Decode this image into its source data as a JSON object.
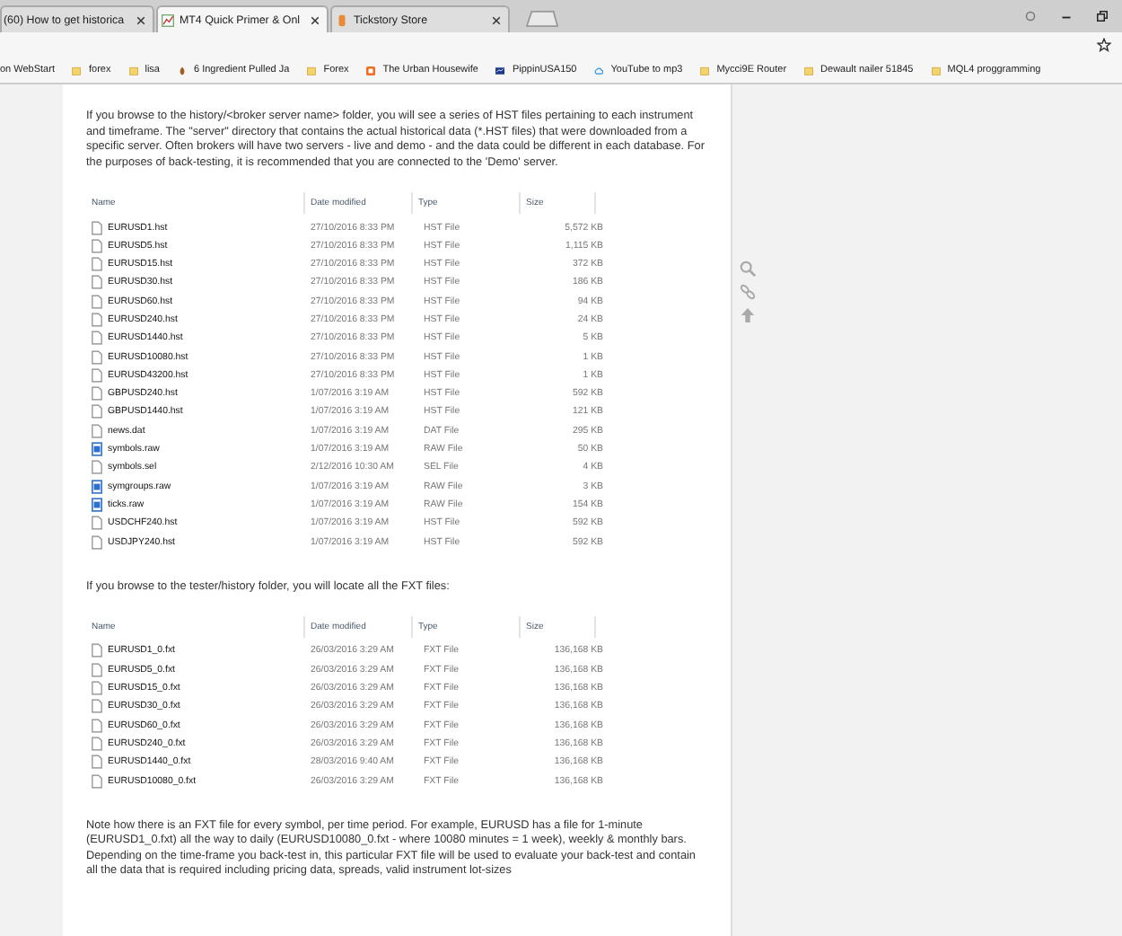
{
  "tabs": [
    {
      "title": "(60) How to get historica",
      "selected": false,
      "kind": "none"
    },
    {
      "title": "MT4 Quick Primer & Onl",
      "selected": true,
      "kind": "chart"
    },
    {
      "title": "Tickstory Store",
      "selected": false,
      "kind": "tag"
    }
  ],
  "bookmarks": [
    {
      "label": "on WebStart",
      "kind": "none"
    },
    {
      "label": "forex",
      "kind": "folder"
    },
    {
      "label": "lisa",
      "kind": "folder"
    },
    {
      "label": "6 Ingredient Pulled Ja",
      "kind": "leaf"
    },
    {
      "label": "Forex",
      "kind": "folder"
    },
    {
      "label": "The Urban Housewife",
      "kind": "blog"
    },
    {
      "label": "PippinUSA150",
      "kind": "site"
    },
    {
      "label": "YouTube to mp3",
      "kind": "cloud"
    },
    {
      "label": "Mycci9E Router",
      "kind": "folder"
    },
    {
      "label": "Dewault nailer 51845",
      "kind": "folder"
    },
    {
      "label": "MQL4 proggramming",
      "kind": "folder"
    }
  ],
  "article": {
    "paragraph_1": "If you browse to the history/<broker server name> folder, you will see a series of HST files pertaining to each instrument and timeframe. The \"server\" directory that contains the actual historical data (*.HST files) that were downloaded from a specific server. Often brokers will have two servers - live and demo - and the data could be different in each database. For the purposes of back-testing, it is recommended that you are connected to the 'Demo' server.",
    "table_1": {
      "columns": [
        "Name",
        "Date modified",
        "Type",
        "Size"
      ],
      "rows": [
        {
          "kind": "file",
          "cells": [
            "EURUSD1.hst",
            "27/10/2016 8:33 PM",
            "HST File",
            "5,572 KB"
          ]
        },
        {
          "kind": "file",
          "cells": [
            "EURUSD5.hst",
            "27/10/2016 8:33 PM",
            "HST File",
            "1,115 KB"
          ]
        },
        {
          "kind": "file",
          "cells": [
            "EURUSD15.hst",
            "27/10/2016 8:33 PM",
            "HST File",
            "372 KB"
          ]
        },
        {
          "kind": "file",
          "cells": [
            "EURUSD30.hst",
            "27/10/2016 8:33 PM",
            "HST File",
            "186 KB"
          ]
        },
        {
          "kind": "file",
          "cells": [
            "EURUSD60.hst",
            "27/10/2016 8:33 PM",
            "HST File",
            "94 KB"
          ]
        },
        {
          "kind": "file",
          "cells": [
            "EURUSD240.hst",
            "27/10/2016 8:33 PM",
            "HST File",
            "24 KB"
          ]
        },
        {
          "kind": "file",
          "cells": [
            "EURUSD1440.hst",
            "27/10/2016 8:33 PM",
            "HST File",
            "5 KB"
          ]
        },
        {
          "kind": "file",
          "cells": [
            "EURUSD10080.hst",
            "27/10/2016 8:33 PM",
            "HST File",
            "1 KB"
          ]
        },
        {
          "kind": "file",
          "cells": [
            "EURUSD43200.hst",
            "27/10/2016 8:33 PM",
            "HST File",
            "1 KB"
          ]
        },
        {
          "kind": "file",
          "cells": [
            "GBPUSD240.hst",
            "1/07/2016 3:19 AM",
            "HST File",
            "592 KB"
          ]
        },
        {
          "kind": "file",
          "cells": [
            "GBPUSD1440.hst",
            "1/07/2016 3:19 AM",
            "HST File",
            "121 KB"
          ]
        },
        {
          "kind": "file",
          "cells": [
            "news.dat",
            "1/07/2016 3:19 AM",
            "DAT File",
            "295 KB"
          ]
        },
        {
          "kind": "raw",
          "cells": [
            "symbols.raw",
            "1/07/2016 3:19 AM",
            "RAW File",
            "50 KB"
          ]
        },
        {
          "kind": "file",
          "cells": [
            "symbols.sel",
            "2/12/2016 10:30 AM",
            "SEL File",
            "4 KB"
          ]
        },
        {
          "kind": "raw",
          "cells": [
            "symgroups.raw",
            "1/07/2016 3:19 AM",
            "RAW File",
            "3 KB"
          ]
        },
        {
          "kind": "raw",
          "cells": [
            "ticks.raw",
            "1/07/2016 3:19 AM",
            "RAW File",
            "154 KB"
          ]
        },
        {
          "kind": "file",
          "cells": [
            "USDCHF240.hst",
            "1/07/2016 3:19 AM",
            "HST File",
            "592 KB"
          ]
        },
        {
          "kind": "file",
          "cells": [
            "USDJPY240.hst",
            "1/07/2016 3:19 AM",
            "HST File",
            "592 KB"
          ]
        }
      ]
    },
    "paragraph_2": "If you browse to the tester/history folder, you will locate all the FXT files:",
    "table_2": {
      "columns": [
        "Name",
        "Date modified",
        "Type",
        "Size"
      ],
      "rows": [
        {
          "kind": "file",
          "cells": [
            "EURUSD1_0.fxt",
            "26/03/2016 3:29 AM",
            "FXT File",
            "136,168 KB"
          ]
        },
        {
          "kind": "file",
          "cells": [
            "EURUSD5_0.fxt",
            "26/03/2016 3:29 AM",
            "FXT File",
            "136,168 KB"
          ]
        },
        {
          "kind": "file",
          "cells": [
            "EURUSD15_0.fxt",
            "26/03/2016 3:29 AM",
            "FXT File",
            "136,168 KB"
          ]
        },
        {
          "kind": "file",
          "cells": [
            "EURUSD30_0.fxt",
            "26/03/2016 3:29 AM",
            "FXT File",
            "136,168 KB"
          ]
        },
        {
          "kind": "file",
          "cells": [
            "EURUSD60_0.fxt",
            "26/03/2016 3:29 AM",
            "FXT File",
            "136,168 KB"
          ]
        },
        {
          "kind": "file",
          "cells": [
            "EURUSD240_0.fxt",
            "26/03/2016 3:29 AM",
            "FXT File",
            "136,168 KB"
          ]
        },
        {
          "kind": "file",
          "cells": [
            "EURUSD1440_0.fxt",
            "28/03/2016 9:40 AM",
            "FXT File",
            "136,168 KB"
          ]
        },
        {
          "kind": "file",
          "cells": [
            "EURUSD10080_0.fxt",
            "26/03/2016 3:29 AM",
            "FXT File",
            "136,168 KB"
          ]
        }
      ]
    },
    "paragraph_3": "Note how there is an FXT file for every symbol, per time period. For example, EURUSD has a file for 1-minute (EURUSD1_0.fxt) all the way to daily (EURUSD10080_0.fxt - where 10080 minutes = 1 week), weekly & monthly bars. Depending on the time-frame you back-test in, this particular FXT file will be used to evaluate your back-test and contain all the data that is required including pricing data, spreads, valid instrument lot-sizes"
  }
}
